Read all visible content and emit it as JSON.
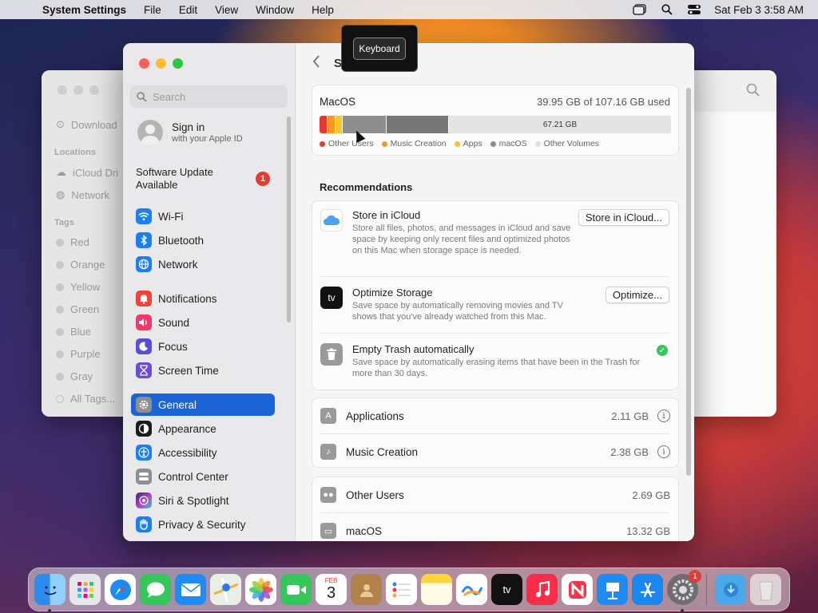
{
  "menubar": {
    "app_name": "System Settings",
    "menus": [
      "File",
      "Edit",
      "View",
      "Window",
      "Help"
    ],
    "datetime": "Sat Feb 3  3:58 AM"
  },
  "finder_bg": {
    "recent": "Download",
    "locations_header": "Locations",
    "icloud": "iCloud Dri",
    "network": "Network",
    "tags_header": "Tags",
    "tags": [
      "Red",
      "Orange",
      "Yellow",
      "Green",
      "Blue",
      "Purple",
      "Gray",
      "All Tags..."
    ]
  },
  "tooltip": {
    "label": "Keyboard"
  },
  "sidebar": {
    "search_placeholder": "Search",
    "signin_title": "Sign in",
    "signin_sub": "with your Apple ID",
    "software_update": "Software Update Available",
    "update_badge": "1",
    "items": [
      {
        "label": "Wi-Fi",
        "icon": "wifi-icon",
        "color": "#1a7ef5"
      },
      {
        "label": "Bluetooth",
        "icon": "bluetooth-icon",
        "color": "#1a7ef5"
      },
      {
        "label": "Network",
        "icon": "globe-icon",
        "color": "#1a7ef5"
      },
      {
        "label": "Notifications",
        "icon": "bell-icon",
        "color": "#f2413a"
      },
      {
        "label": "Sound",
        "icon": "speaker-icon",
        "color": "#f0396a"
      },
      {
        "label": "Focus",
        "icon": "moon-icon",
        "color": "#5b4dd6"
      },
      {
        "label": "Screen Time",
        "icon": "hourglass-icon",
        "color": "#6a4cd6"
      },
      {
        "label": "General",
        "icon": "gear-icon",
        "color": "#8e8e93"
      },
      {
        "label": "Appearance",
        "icon": "appearance-icon",
        "color": "#1c1c1e"
      },
      {
        "label": "Accessibility",
        "icon": "accessibility-icon",
        "color": "#1a7ef5"
      },
      {
        "label": "Control Center",
        "icon": "control-center-icon",
        "color": "#8e8e93"
      },
      {
        "label": "Siri & Spotlight",
        "icon": "siri-icon",
        "color": "#a43cc7"
      },
      {
        "label": "Privacy & Security",
        "icon": "hand-icon",
        "color": "#1a7ef5"
      }
    ]
  },
  "content": {
    "title": "S",
    "storage": {
      "disk_name": "MacOS",
      "used_text": "39.95 GB of 107.16 GB used",
      "free_text": "67.21 GB",
      "legend": [
        {
          "label": "Other Users",
          "color": "#e8392f"
        },
        {
          "label": "Music Creation",
          "color": "#f39a1d"
        },
        {
          "label": "Apps",
          "color": "#f5c72a"
        },
        {
          "label": "macOS",
          "color": "#8e8e8e"
        },
        {
          "label": "Other Volumes",
          "color": "#e0e0e0"
        }
      ]
    },
    "recommendations_header": "Recommendations",
    "recommendations": [
      {
        "title": "Store in iCloud",
        "desc": "Store all files, photos, and messages in iCloud and save space by keeping only recent files and optimized photos on this Mac when storage space is needed.",
        "button": "Store in iCloud..."
      },
      {
        "title": "Optimize Storage",
        "desc": "Save space by automatically removing movies and TV shows that you've already watched from this Mac.",
        "button": "Optimize...",
        "icon_text": "tv"
      },
      {
        "title": "Empty Trash automatically",
        "desc": "Save space by automatically erasing items that have been in the Trash for more than 30 days.",
        "check": "✓"
      }
    ],
    "categories": [
      {
        "name": "Applications",
        "size": "2.11 GB"
      },
      {
        "name": "Music Creation",
        "size": "2.38 GB"
      },
      {
        "name": "Other Users",
        "size": "2.69 GB"
      },
      {
        "name": "macOS",
        "size": "13.32 GB"
      }
    ]
  },
  "dock": {
    "calendar_month": "FEB",
    "calendar_day": "3",
    "settings_badge": "1"
  }
}
